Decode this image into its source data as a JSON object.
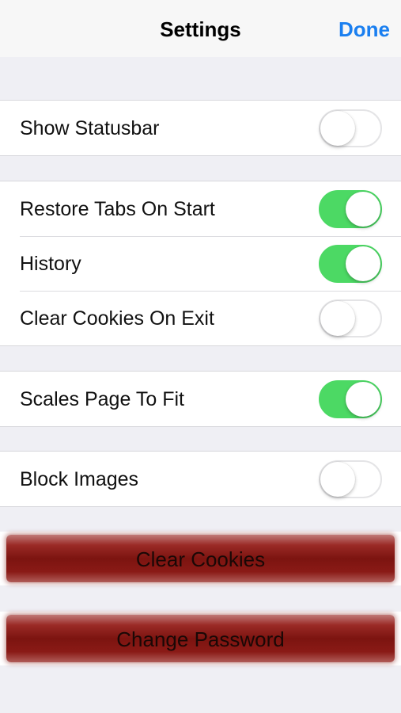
{
  "nav": {
    "title": "Settings",
    "done_label": "Done"
  },
  "groups": [
    {
      "rows": [
        {
          "label": "Show Statusbar",
          "on": false
        }
      ]
    },
    {
      "rows": [
        {
          "label": "Restore Tabs On Start",
          "on": true
        },
        {
          "label": "History",
          "on": true
        },
        {
          "label": "Clear Cookies On Exit",
          "on": false
        }
      ]
    },
    {
      "rows": [
        {
          "label": "Scales Page To Fit",
          "on": true
        }
      ]
    },
    {
      "rows": [
        {
          "label": "Block Images",
          "on": false
        }
      ]
    }
  ],
  "buttons": {
    "clear_cookies": "Clear Cookies",
    "change_password": "Change Password"
  },
  "colors": {
    "accent": "#1a7ff0",
    "toggle_on": "#4cd964",
    "button_red": "#7c1410",
    "background": "#efeff4"
  }
}
